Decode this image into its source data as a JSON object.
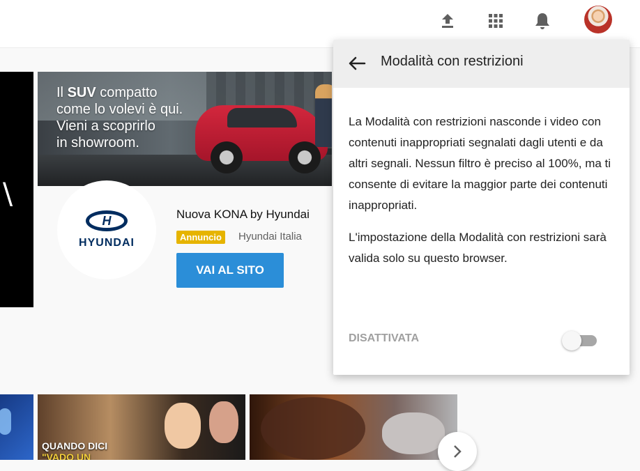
{
  "header": {
    "icons": [
      "upload-icon",
      "apps-grid-icon",
      "bell-icon"
    ]
  },
  "ad": {
    "banner_copy": {
      "line1_prefix": "Il",
      "line1_bold": "SUV",
      "line1_suffix": "compatto",
      "line2": "come lo volevi è qui.",
      "line3": "Vieni a scoprirlo",
      "line4": "in showroom."
    },
    "brand_wordmark": "HYUNDAI",
    "brand_mark": "H",
    "title": "Nuova KONA by Hyundai",
    "badge": "Annuncio",
    "advertiser": "Hyundai Italia",
    "cta": "VAI AL SITO",
    "left_tile_glyph": "\\"
  },
  "thumbnails": {
    "thumb1_text": "QUANDO DICI",
    "thumb1_subtext": "\"VADO UN"
  },
  "carousel": {
    "next_icon": "chevron-right-icon"
  },
  "panel": {
    "title": "Modalità con restrizioni",
    "paragraph1": "La Modalità con restrizioni nasconde i video con contenuti inappropriati segnalati dagli utenti e da altri segnali. Nessun filtro è preciso al 100%, ma ti consente di evitare la maggior parte dei contenuti inappropriati.",
    "paragraph2": "L'impostazione della Modalità con restrizioni sarà valida solo su questo browser.",
    "toggle_label": "DISATTIVATA",
    "toggle_state": false
  },
  "colors": {
    "cta_blue": "#2b8ed8",
    "badge_yellow": "#e6b400",
    "brand_navy": "#002c5f"
  }
}
